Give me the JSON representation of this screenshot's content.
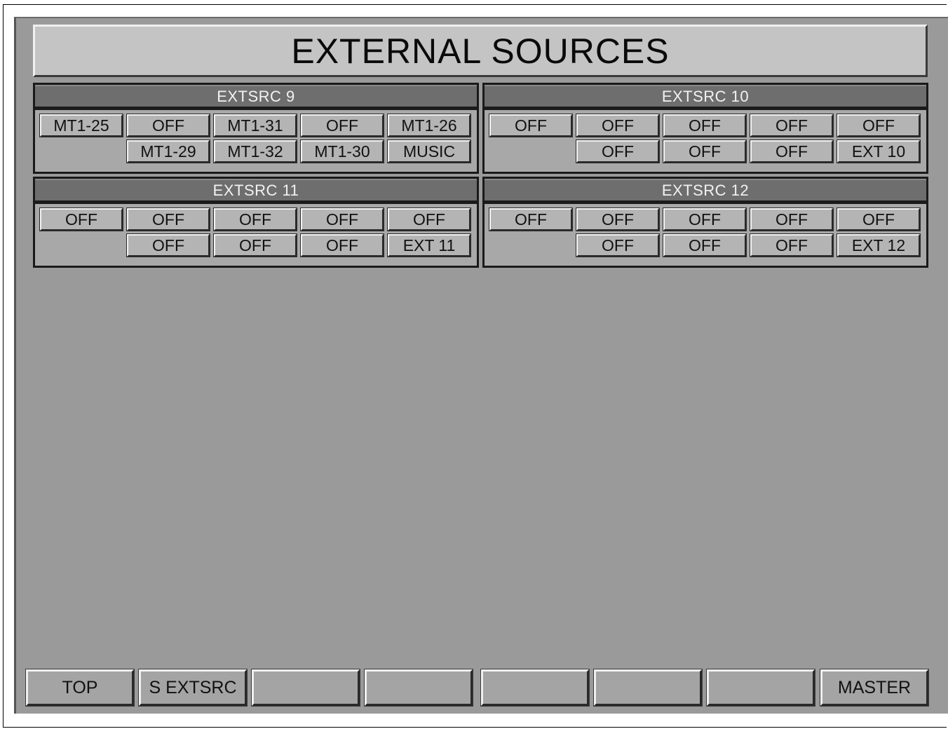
{
  "title": "EXTERNAL SOURCES",
  "panels": [
    {
      "name": "EXTSRC 9",
      "row1": [
        "MT1-25",
        "OFF",
        "MT1-31",
        "OFF",
        "MT1-26"
      ],
      "row2": [
        "MT1-29",
        "MT1-32",
        "MT1-30",
        "MUSIC"
      ]
    },
    {
      "name": "EXTSRC 10",
      "row1": [
        "OFF",
        "OFF",
        "OFF",
        "OFF",
        "OFF"
      ],
      "row2": [
        "OFF",
        "OFF",
        "OFF",
        "EXT 10"
      ]
    },
    {
      "name": "EXTSRC 11",
      "row1": [
        "OFF",
        "OFF",
        "OFF",
        "OFF",
        "OFF"
      ],
      "row2": [
        "OFF",
        "OFF",
        "OFF",
        "EXT 11"
      ]
    },
    {
      "name": "EXTSRC 12",
      "row1": [
        "OFF",
        "OFF",
        "OFF",
        "OFF",
        "OFF"
      ],
      "row2": [
        "OFF",
        "OFF",
        "OFF",
        "EXT 12"
      ]
    }
  ],
  "nav": [
    "TOP",
    "S EXTSRC",
    "",
    "",
    "",
    "",
    "",
    "MASTER"
  ]
}
